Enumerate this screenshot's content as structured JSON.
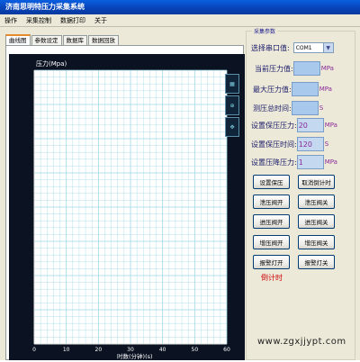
{
  "window": {
    "title": "济南思明特压力采集系统"
  },
  "menu": [
    "操作",
    "采集控制",
    "数据打印",
    "关于"
  ],
  "tabs": [
    "曲线图",
    "参数设定",
    "数据库",
    "数据回放"
  ],
  "chart_data": {
    "type": "line",
    "title": "",
    "ylabel": "压力(Mpa)",
    "xlabel": "时数(分钟)(s)",
    "x_ticks": [
      "0",
      "10",
      "20",
      "30",
      "40",
      "50",
      "60"
    ],
    "y_ticks": [],
    "xlim": [
      0,
      60
    ],
    "grid": true,
    "series": []
  },
  "panel": {
    "group_title": "采集参数",
    "port_label": "选择串口值:",
    "port_value": "COM1",
    "current_pressure_label": "当前压力值:",
    "max_pressure_label": "最大压力值:",
    "total_time_label": "测压总时间:",
    "set_hold_pressure_label": "设置保压压力:",
    "set_hold_pressure_value": "20",
    "set_hold_time_label": "设置保压时间:",
    "set_hold_time_value": "120",
    "set_drop_pressure_label": "设置压降压力:",
    "set_drop_pressure_value": "1",
    "unit_mpa": "MPa",
    "unit_s": "S"
  },
  "buttons": {
    "set_hold": "设置保压",
    "cancel_countdown": "取消倒计时",
    "pressure_valve_open": "泄压阀开",
    "pressure_valve_close": "泄压阀关",
    "fill_valve_open": "进压阀开",
    "fill_valve_close": "进压阀关",
    "boost_valve_open": "增压阀开",
    "boost_valve_close": "增压阀关",
    "alarm_on": "报警灯开",
    "alarm_off": "报警灯关"
  },
  "status": {
    "countdown": "倒计时"
  },
  "watermark": "www.zgxjjypt.com",
  "colors": {
    "chart_bg": "#0b1322",
    "plot_bg": "#ffffff",
    "grid": "#9fd8e6",
    "axis_text": "#ffffff"
  }
}
